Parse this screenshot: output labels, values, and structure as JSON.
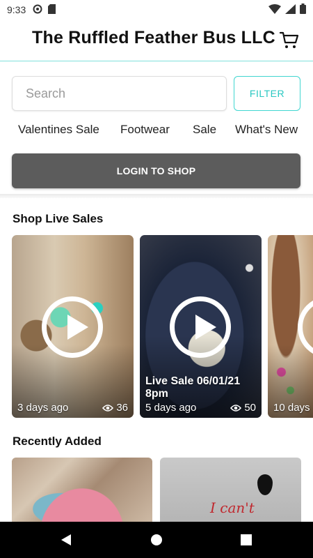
{
  "status_bar": {
    "time": "9:33"
  },
  "header": {
    "title": "The Ruffled Feather Bus LLC"
  },
  "search": {
    "placeholder": "Search"
  },
  "filter": {
    "label": "FILTER"
  },
  "categories": [
    "Valentines Sale",
    "Footwear",
    "Sale",
    "What's New"
  ],
  "login": {
    "label": "LOGIN TO SHOP"
  },
  "live_sales": {
    "title": "Shop Live Sales",
    "cards": [
      {
        "title": "",
        "time_ago": "3 days ago",
        "views": "36"
      },
      {
        "title": "Live Sale 06/01/21 8pm",
        "time_ago": "5 days ago",
        "views": "50"
      },
      {
        "title": "",
        "time_ago": "10 days",
        "views": ""
      }
    ]
  },
  "recently_added": {
    "title": "Recently Added",
    "shirt_text": "I can't"
  },
  "colors": {
    "accent": "#28c7c1",
    "login_bg": "#5c5c5c",
    "header_border": "#7fe0dc"
  }
}
